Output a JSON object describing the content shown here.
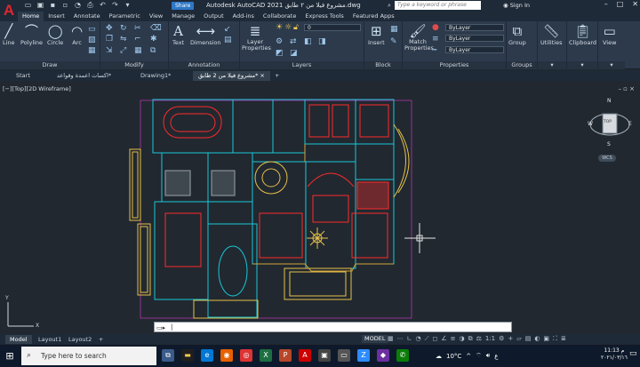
{
  "titlebar": {
    "app_letter": "A",
    "share_label": "Share",
    "title": "Autodesk AutoCAD 2021   مشروع فيلا من ٢ طابق.dwg",
    "search_placeholder": "Type a keyword or phrase",
    "signin_label": "Sign In"
  },
  "ribbon_tabs": [
    "Home",
    "Insert",
    "Annotate",
    "Parametric",
    "View",
    "Manage",
    "Output",
    "Add-ins",
    "Collaborate",
    "Express Tools",
    "Featured Apps"
  ],
  "panels": {
    "draw": {
      "title": "Draw",
      "line": "Line",
      "polyline": "Polyline",
      "circle": "Circle",
      "arc": "Arc"
    },
    "modify": {
      "title": "Modify"
    },
    "annotation": {
      "title": "Annotation",
      "text": "Text",
      "dimension": "Dimension"
    },
    "layers": {
      "title": "Layers",
      "layer_properties": "Layer Properties",
      "current_layer": "0"
    },
    "block": {
      "title": "Block",
      "insert": "Insert"
    },
    "properties": {
      "title": "Properties",
      "match": "Match Properties",
      "bylayer1": "ByLayer",
      "bylayer2": "ByLayer",
      "bylayer3": "ByLayer"
    },
    "groups": {
      "title": "Groups",
      "group": "Group"
    },
    "utilities": {
      "label": "Utilities"
    },
    "clipboard": {
      "label": "Clipboard"
    },
    "view": {
      "label": "View"
    }
  },
  "file_tabs": {
    "start": "Start",
    "tab1": "اكسات اعمدة وقواعد*",
    "tab2": "Drawing1*",
    "tab3": "مشروع فيلا من 2 طابق*"
  },
  "viewport": {
    "label": "[−][Top][2D Wireframe]",
    "cube_n": "N",
    "cube_s": "S",
    "cube_e": "E",
    "cube_w": "W",
    "cube_top": "TOP",
    "wcs": "WCS"
  },
  "commandline": {
    "value": "|"
  },
  "layout_tabs": [
    "Model",
    "Layout1",
    "Layout2"
  ],
  "statusbar": {
    "model": "MODEL",
    "scale": "1:1"
  },
  "taskbar": {
    "search_placeholder": "Type here to search",
    "weather": "10°C",
    "time": "11:13 م",
    "date": "٢٠٢١/٠٣/١٦"
  },
  "colors": {
    "walls": "#19c8d8",
    "furniture": "#ff2a2a",
    "hatch": "#e6c04a",
    "outline": "#d4c24a",
    "magenta": "#e03ad0"
  }
}
